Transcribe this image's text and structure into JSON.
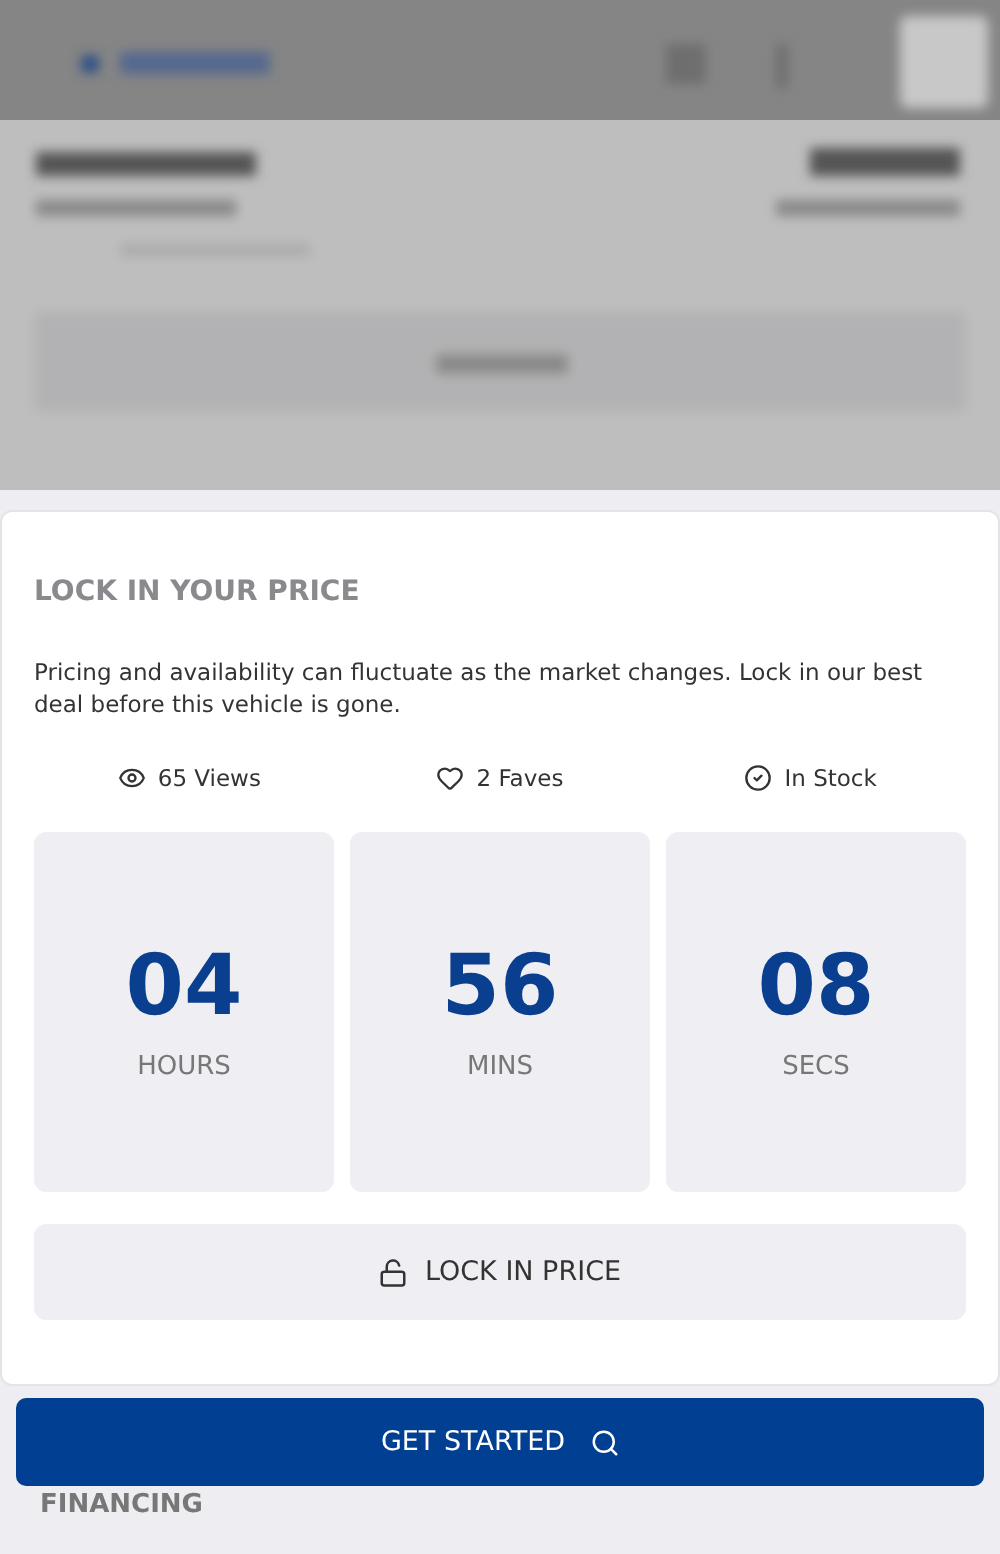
{
  "panel": {
    "title": "LOCK IN YOUR PRICE",
    "description": "Pricing and availability can fluctuate as the market changes. Lock in our best deal before this vehicle is gone."
  },
  "stats": [
    {
      "kind": "views",
      "label": "65 Views"
    },
    {
      "kind": "faves",
      "label": "2 Faves"
    },
    {
      "kind": "stock",
      "label": "In Stock"
    }
  ],
  "countdown": [
    {
      "value": "04",
      "unit": "HOURS"
    },
    {
      "value": "56",
      "unit": "MINS"
    },
    {
      "value": "08",
      "unit": "SECS"
    }
  ],
  "lock_button": {
    "label": "LOCK IN PRICE"
  },
  "cta_button": {
    "label": "GET STARTED"
  },
  "next_section": {
    "title": "FINANCING"
  }
}
